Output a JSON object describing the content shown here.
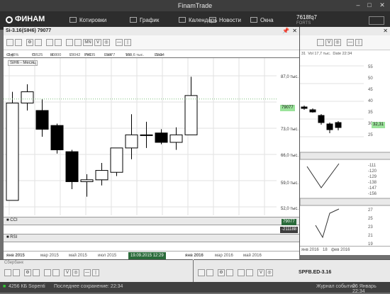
{
  "window": {
    "title": "FinamTrade"
  },
  "menu": {
    "logo": "ФИНАМ",
    "items": [
      {
        "label": "Котировки"
      },
      {
        "label": "График"
      },
      {
        "label": "Календарь"
      },
      {
        "label": "Новости"
      },
      {
        "label": "Окна"
      }
    ],
    "account": {
      "id": "7618fq7",
      "sub": "FORTS"
    }
  },
  "chart_panel": {
    "title": "Si-3.16(SIH6) 79077",
    "series_label": "SiH6 - Месяц",
    "info": [
      {
        "label": "Chg",
        "value": "-0,45%"
      },
      {
        "label": "O",
        "value": "79525"
      },
      {
        "label": "H",
        "value": "80800"
      },
      {
        "label": "L",
        "value": "78042"
      },
      {
        "label": "PrC",
        "value": "79435"
      },
      {
        "label": "Last",
        "value": "79077"
      },
      {
        "label": "Vol",
        "value": "109,6 тыс."
      },
      {
        "label": "Date",
        "value": "22:34"
      }
    ],
    "price_tag": "79077",
    "y_ticks": [
      "87,0 тыс.",
      "80,0 тыс.",
      "73,0 тыс.",
      "66,0 тыс.",
      "59,0 тыс.",
      "52,0 тыс."
    ],
    "indicators": [
      {
        "name": "CCI",
        "value": "79077"
      },
      {
        "name": "RSI",
        "value": "-211188"
      }
    ],
    "x_ticks": [
      "янв 2015",
      "мар 2015",
      "май 2015",
      "июл 2015",
      "сен 2015",
      "янв 2016",
      "мар 2016",
      "май 2016"
    ],
    "cursor_date": "19.09.2015 12:29"
  },
  "chart_data": {
    "type": "candlestick",
    "series_name": "SiH6 - Месяц",
    "candles": [
      {
        "o": 52.0,
        "h": 81.0,
        "l": 52.0,
        "c": 78.0
      },
      {
        "o": 78.0,
        "h": 83.0,
        "l": 76.0,
        "c": 81.0
      },
      {
        "o": 76.0,
        "h": 79.0,
        "l": 69.0,
        "c": 71.0
      },
      {
        "o": 72.0,
        "h": 72.5,
        "l": 64.5,
        "c": 65.5
      },
      {
        "o": 65.0,
        "h": 65.5,
        "l": 55.0,
        "c": 57.0
      },
      {
        "o": 57.0,
        "h": 59.0,
        "l": 53.0,
        "c": 57.5
      },
      {
        "o": 57.5,
        "h": 62.0,
        "l": 56.0,
        "c": 60.0
      },
      {
        "o": 59.5,
        "h": 66.0,
        "l": 58.5,
        "c": 66.0
      },
      {
        "o": 66.0,
        "h": 75.0,
        "l": 63.0,
        "c": 69.5
      },
      {
        "o": 69.5,
        "h": 73.0,
        "l": 66.0,
        "c": 69.5
      },
      {
        "o": 70.0,
        "h": 71.0,
        "l": 67.0,
        "c": 67.5
      },
      {
        "o": 67.5,
        "h": 71.5,
        "l": 65.5,
        "c": 69.5
      },
      {
        "o": 69.5,
        "h": 85.0,
        "l": 74.5,
        "c": 80.0
      }
    ],
    "ylim": [
      48,
      90
    ]
  },
  "right_panel": {
    "header": [
      "31",
      "Vol 17,7 тыс.",
      "Date 22:34"
    ],
    "y_ticks": [
      "55",
      "50",
      "45",
      "40",
      "35",
      "30",
      "25"
    ],
    "price_tag": "32,31",
    "ind1_ticks": [
      "-111",
      "-120",
      "-129",
      "-138",
      "-147",
      "-156"
    ],
    "ind2_ticks": [
      "27",
      "25",
      "23",
      "21",
      "19"
    ],
    "x_ticks": [
      "янв 2016",
      "18",
      "фев 2016"
    ]
  },
  "bottom_left": {
    "title": "Сбербанк"
  },
  "bottom_right": {
    "title": "SPFB.ED-3.16"
  },
  "status": {
    "balance": "4256 КБ",
    "broker": "Sopenti",
    "saved": "Последнее сохранение: 22:34",
    "journal": "Журнал событий",
    "date": "26 Январь 22:34"
  }
}
